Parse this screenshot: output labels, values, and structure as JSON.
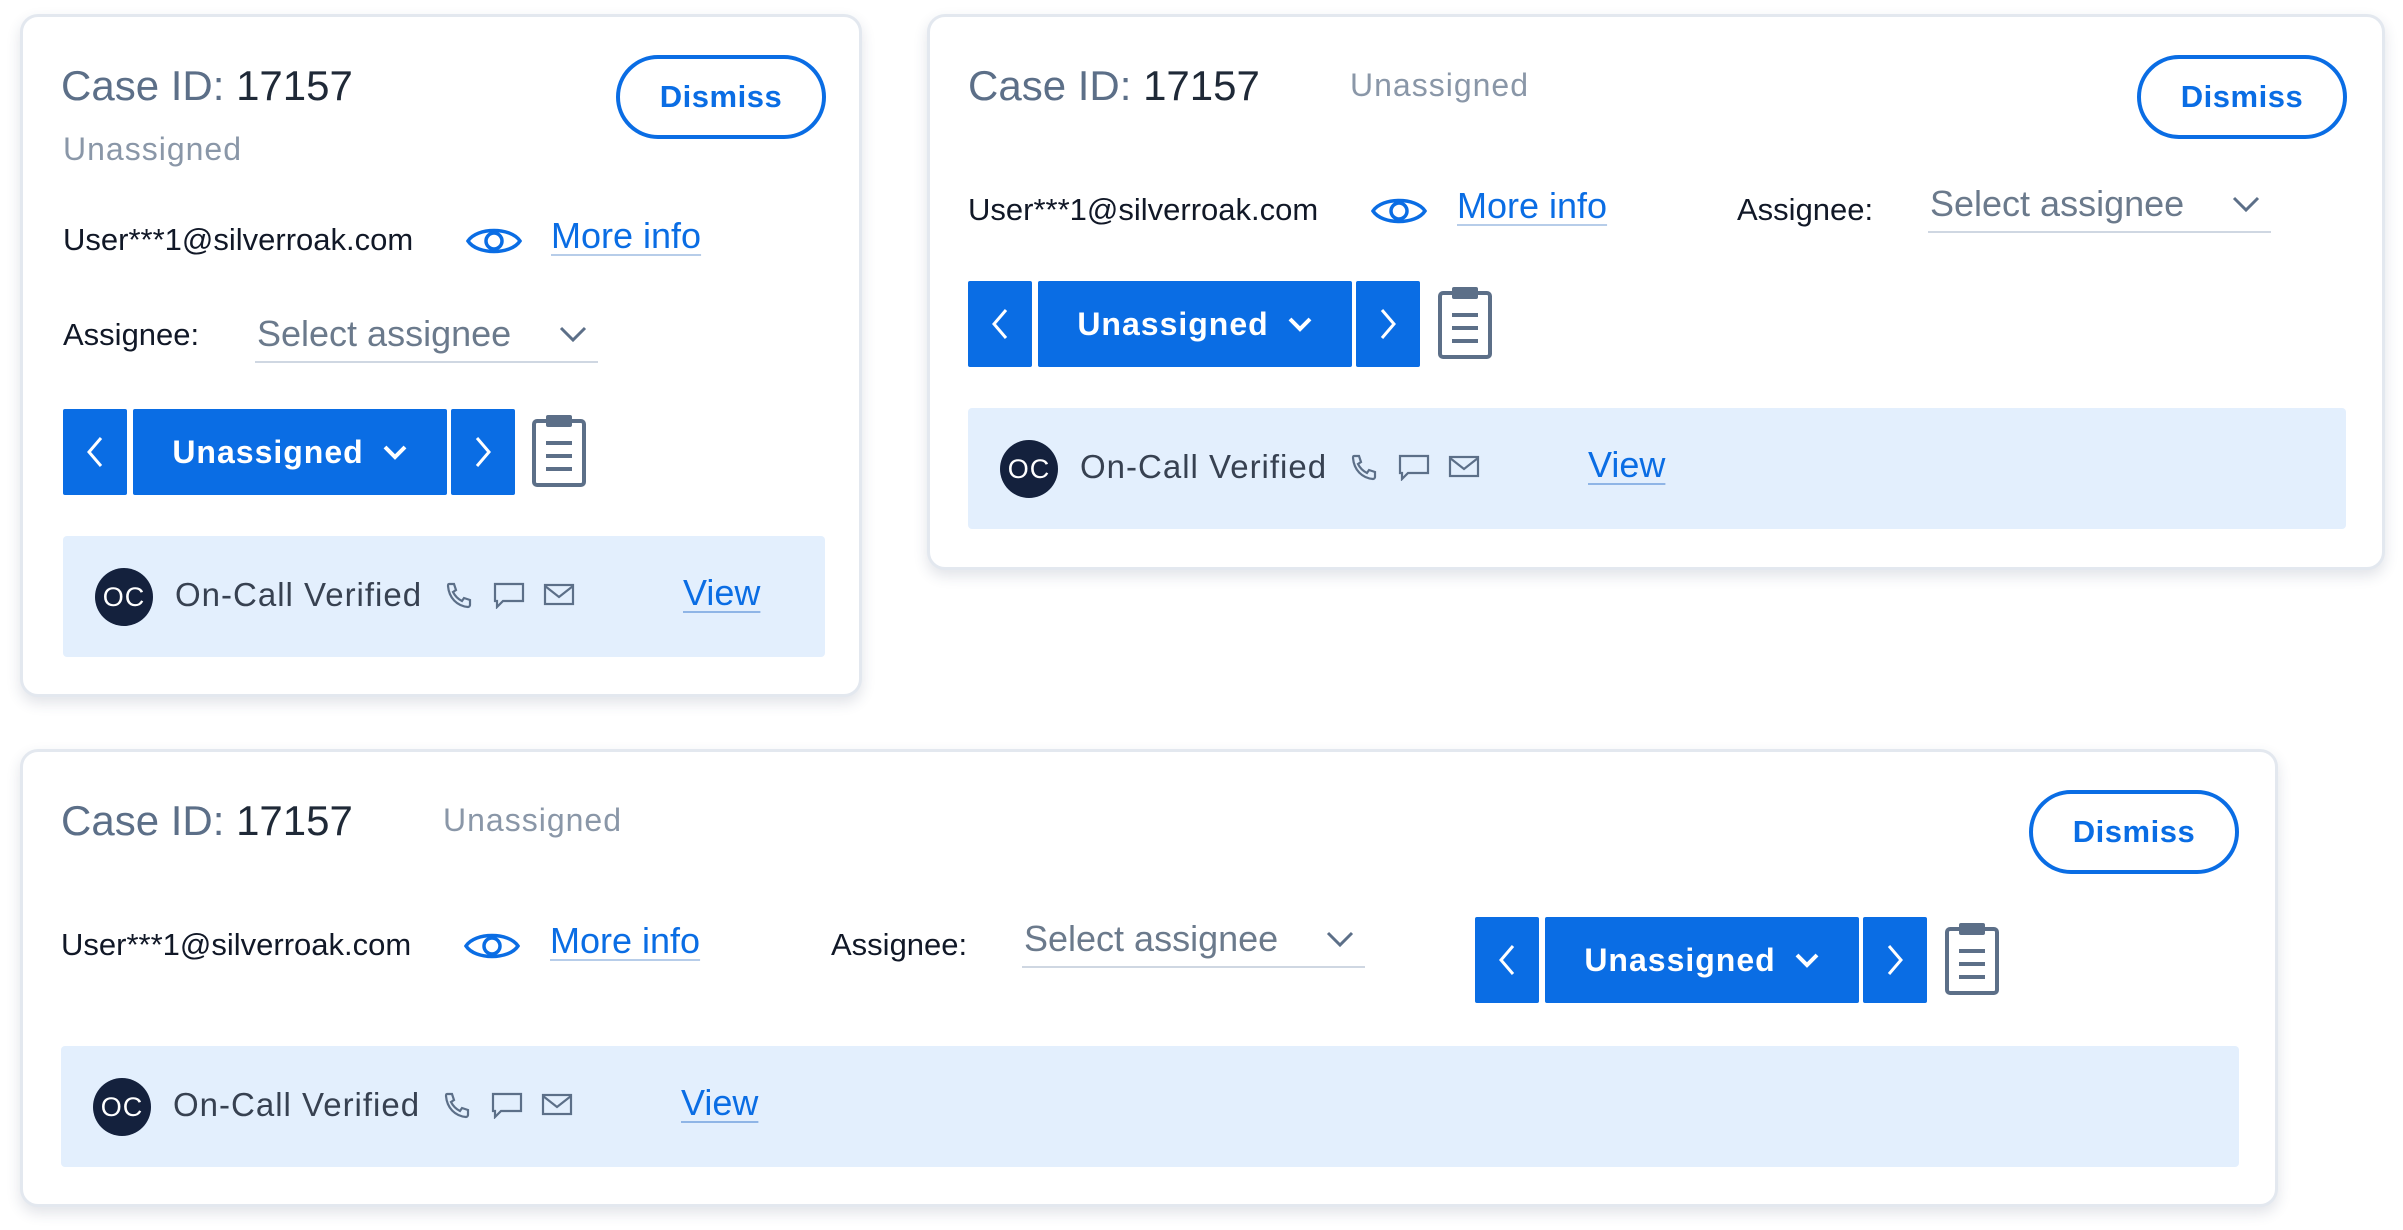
{
  "case": {
    "id_label": "Case ID:",
    "id_value": "17157",
    "status": "Unassigned",
    "dismiss_label": "Dismiss",
    "email": "User***1@silverroak.com",
    "more_info_label": "More info",
    "assignee_label": "Assignee:",
    "assignee_placeholder": "Select assignee",
    "stage_label": "Unassigned",
    "contact": {
      "initials": "OC",
      "name": "On-Call Verified",
      "view_label": "View"
    }
  },
  "icons": {
    "eye": "eye-icon",
    "select_chevron": "chevron-down-icon",
    "prev": "chevron-left-icon",
    "next": "chevron-right-icon",
    "stage_dropdown": "chevron-down-icon",
    "notes": "clipboard-icon",
    "phone": "phone-icon",
    "chat": "chat-icon",
    "mail": "mail-icon"
  },
  "colors": {
    "accent": "#0a6de4",
    "contact_bar": "#e3effd",
    "avatar": "#14213d",
    "muted_text": "#8a97a8",
    "icon_gray": "#5c6f88"
  }
}
